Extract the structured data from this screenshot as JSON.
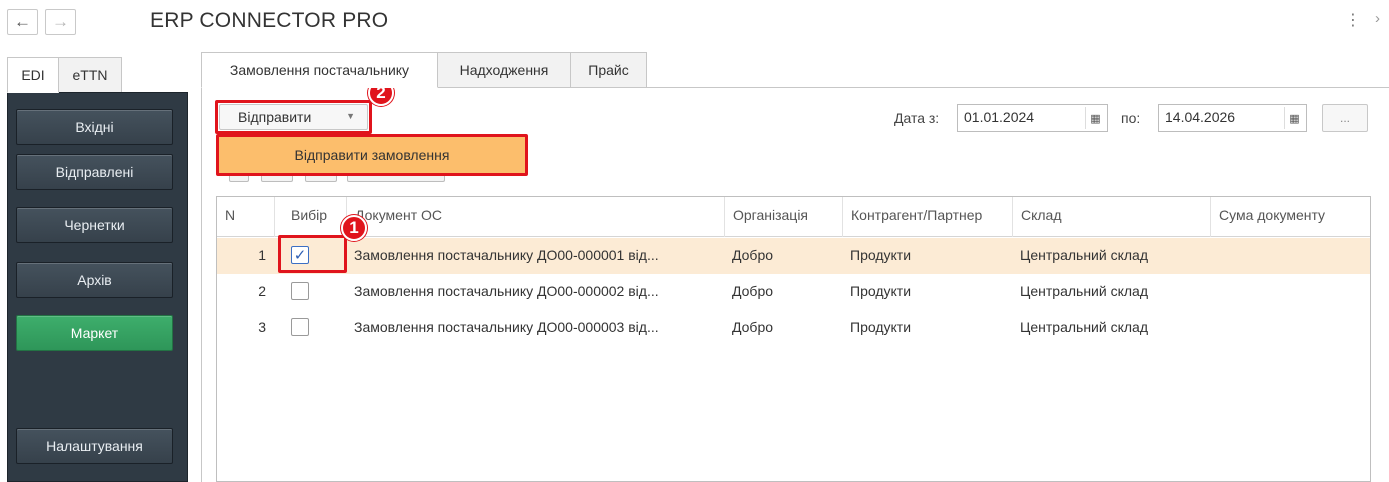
{
  "app": {
    "title": "ERP CONNECTOR PRO"
  },
  "nav": {
    "back_glyph": "←",
    "forward_glyph": "→",
    "more_glyph": "⋮",
    "chevron_glyph": "›"
  },
  "left_tabs": [
    {
      "label": "EDI",
      "active": true
    },
    {
      "label": "eTTN",
      "active": false
    }
  ],
  "sidebar": {
    "items": [
      {
        "label": "Вхідні"
      },
      {
        "label": "Відправлені"
      },
      {
        "label": "Чернетки"
      },
      {
        "label": "Архів"
      },
      {
        "label": "Маркет",
        "active": true
      }
    ],
    "settings_label": "Налаштування"
  },
  "main_tabs": [
    {
      "label": "Замовлення постачальнику",
      "active": true
    },
    {
      "label": "Надходження"
    },
    {
      "label": "Прайс"
    }
  ],
  "toolbar": {
    "send_label": "Відправити",
    "dropdown_item": "Відправити замовлення",
    "date_from_label": "Дата з:",
    "date_from": "01.01.2024",
    "date_to_label": "по:",
    "date_to": "14.04.2026",
    "ellipsis": "..."
  },
  "badges": {
    "one": "1",
    "two": "2"
  },
  "table": {
    "columns": [
      "N",
      "Вибір",
      "Документ ОС",
      "Організація",
      "Контрагент/Партнер",
      "Склад",
      "Сума документу"
    ],
    "rows": [
      {
        "n": "1",
        "checked": true,
        "check_glyph": "✓",
        "doc": "Замовлення постачальнику ДО00-000001 від...",
        "org": "Добро",
        "partner": "Продукти",
        "warehouse": "Центральний склад",
        "sum": ""
      },
      {
        "n": "2",
        "checked": false,
        "check_glyph": "",
        "doc": "Замовлення постачальнику ДО00-000002 від...",
        "org": "Добро",
        "partner": "Продукти",
        "warehouse": "Центральний склад",
        "sum": ""
      },
      {
        "n": "3",
        "checked": false,
        "check_glyph": "",
        "doc": "Замовлення постачальнику ДО00-000003 від...",
        "org": "Добро",
        "partner": "Продукти",
        "warehouse": "Центральний склад",
        "sum": ""
      }
    ]
  },
  "colors": {
    "highlight": "#e0141c",
    "accent_green": "#3eae6c",
    "selected_row": "#fcebd5",
    "menu_item": "#fcbe6c",
    "sidebar_bg": "#2f3a44"
  }
}
